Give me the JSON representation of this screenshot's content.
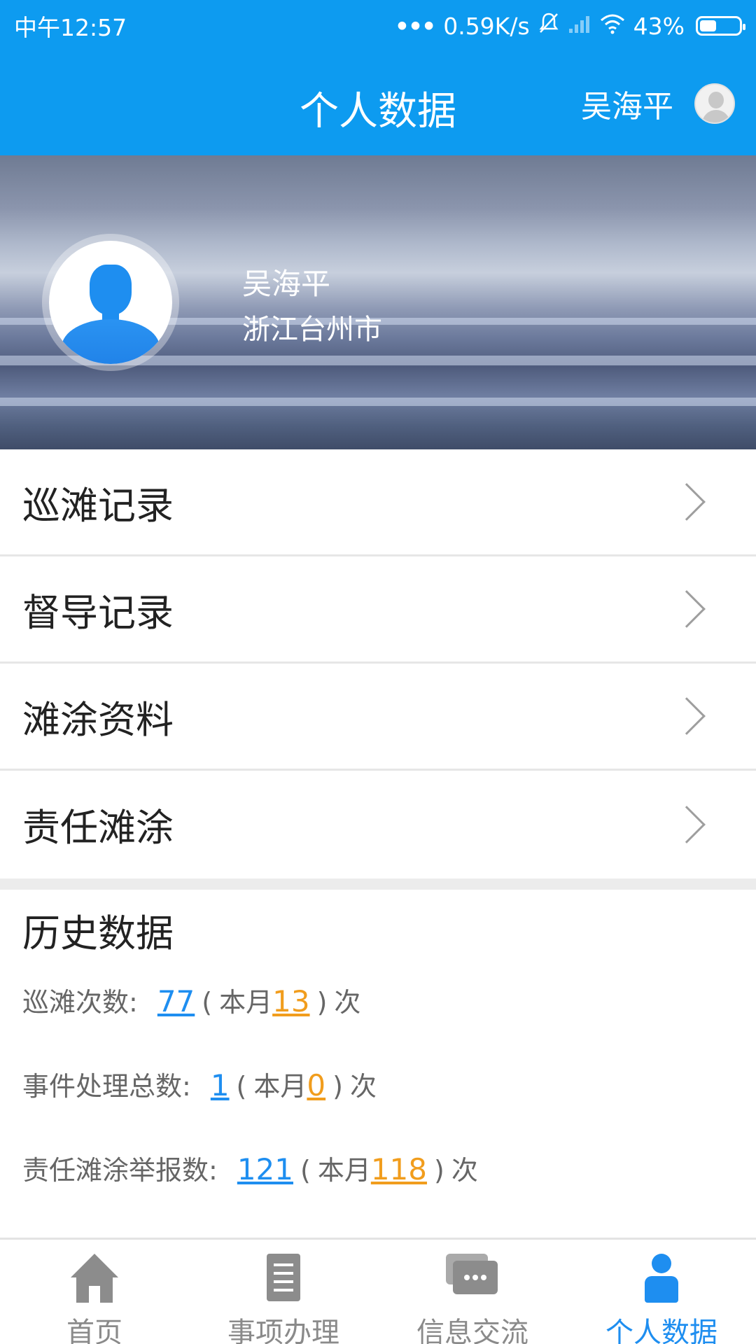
{
  "status_bar": {
    "time": "中午12:57",
    "network_speed": "0.59K/s",
    "battery": "43%",
    "battery_level": 0.43,
    "icons": [
      "more-dots-icon",
      "mute-icon",
      "signal-icon",
      "wifi-icon",
      "battery-icon"
    ]
  },
  "app_bar": {
    "title": "个人数据",
    "user_name": "吴海平"
  },
  "profile": {
    "name": "吴海平",
    "city": "浙江台州市"
  },
  "menu": {
    "items": [
      {
        "label": "巡滩记录"
      },
      {
        "label": "督导记录"
      },
      {
        "label": "滩涂资料"
      },
      {
        "label": "责任滩涂"
      }
    ]
  },
  "history": {
    "title": "历史数据",
    "rows": [
      {
        "label": "巡滩次数:",
        "total": "77",
        "month_prefix": "本月",
        "month": "13",
        "suffix": "次"
      },
      {
        "label": "事件处理总数:",
        "total": "1",
        "month_prefix": "本月",
        "month": "0",
        "suffix": "次"
      },
      {
        "label": "责任滩涂举报数:",
        "total": "121",
        "month_prefix": "本月",
        "month": "118",
        "suffix": "次"
      }
    ]
  },
  "bottom_nav": {
    "items": [
      {
        "label": "首页",
        "icon": "home-icon",
        "active": false
      },
      {
        "label": "事项办理",
        "icon": "document-icon",
        "active": false
      },
      {
        "label": "信息交流",
        "icon": "chat-icon",
        "active": false
      },
      {
        "label": "个人数据",
        "icon": "person-icon",
        "active": true
      }
    ]
  },
  "colors": {
    "primary": "#0d9bf0",
    "link_blue": "#1e8ef0",
    "month_orange": "#f19d1d",
    "inactive_gray": "#8c8c8c"
  }
}
